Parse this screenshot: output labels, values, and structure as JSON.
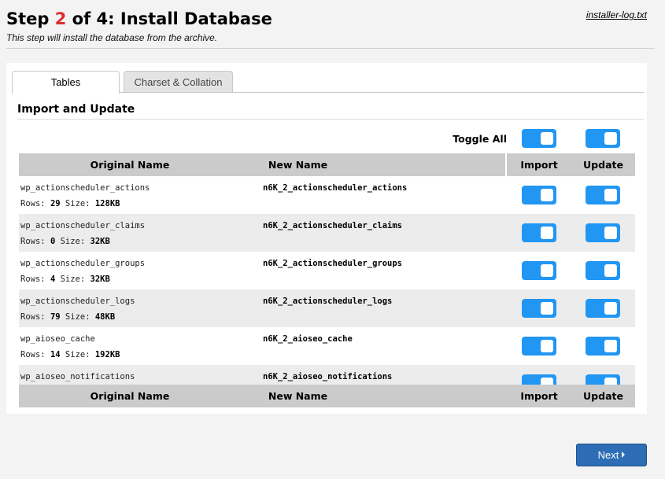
{
  "header": {
    "title_prefix": "Step ",
    "title_step": "2",
    "title_suffix": " of 4: Install Database",
    "subtitle": "This step will install the database from the archive.",
    "log_link": "installer-log.txt"
  },
  "tabs": [
    {
      "label": "Tables",
      "active": true
    },
    {
      "label": "Charset & Collation",
      "active": false
    }
  ],
  "section": {
    "title": "Import and Update",
    "toggle_all_label": "Toggle All"
  },
  "columns": {
    "original": "Original Name",
    "new": "New Name",
    "import": "Import",
    "update": "Update"
  },
  "rows": [
    {
      "original": "wp_actionscheduler_actions",
      "rows_label": "Rows:",
      "rows": "29",
      "size_label": "Size:",
      "size": "128KB",
      "new": "n6K_2_actionscheduler_actions",
      "import": true,
      "update": true
    },
    {
      "original": "wp_actionscheduler_claims",
      "rows_label": "Rows:",
      "rows": "0",
      "size_label": "Size:",
      "size": "32KB",
      "new": "n6K_2_actionscheduler_claims",
      "import": true,
      "update": true
    },
    {
      "original": "wp_actionscheduler_groups",
      "rows_label": "Rows:",
      "rows": "4",
      "size_label": "Size:",
      "size": "32KB",
      "new": "n6K_2_actionscheduler_groups",
      "import": true,
      "update": true
    },
    {
      "original": "wp_actionscheduler_logs",
      "rows_label": "Rows:",
      "rows": "79",
      "size_label": "Size:",
      "size": "48KB",
      "new": "n6K_2_actionscheduler_logs",
      "import": true,
      "update": true
    },
    {
      "original": "wp_aioseo_cache",
      "rows_label": "Rows:",
      "rows": "14",
      "size_label": "Size:",
      "size": "192KB",
      "new": "n6K_2_aioseo_cache",
      "import": true,
      "update": true
    },
    {
      "original": "wp_aioseo_notifications",
      "rows_label": "Rows:",
      "rows": "",
      "size_label": "",
      "size": "",
      "new": "n6K_2_aioseo_notifications",
      "import": true,
      "update": true
    }
  ],
  "footer": {
    "next_label": "Next"
  },
  "colors": {
    "accent": "#2196f3",
    "step_number": "#e12b2b",
    "next_button": "#2d6db5"
  }
}
